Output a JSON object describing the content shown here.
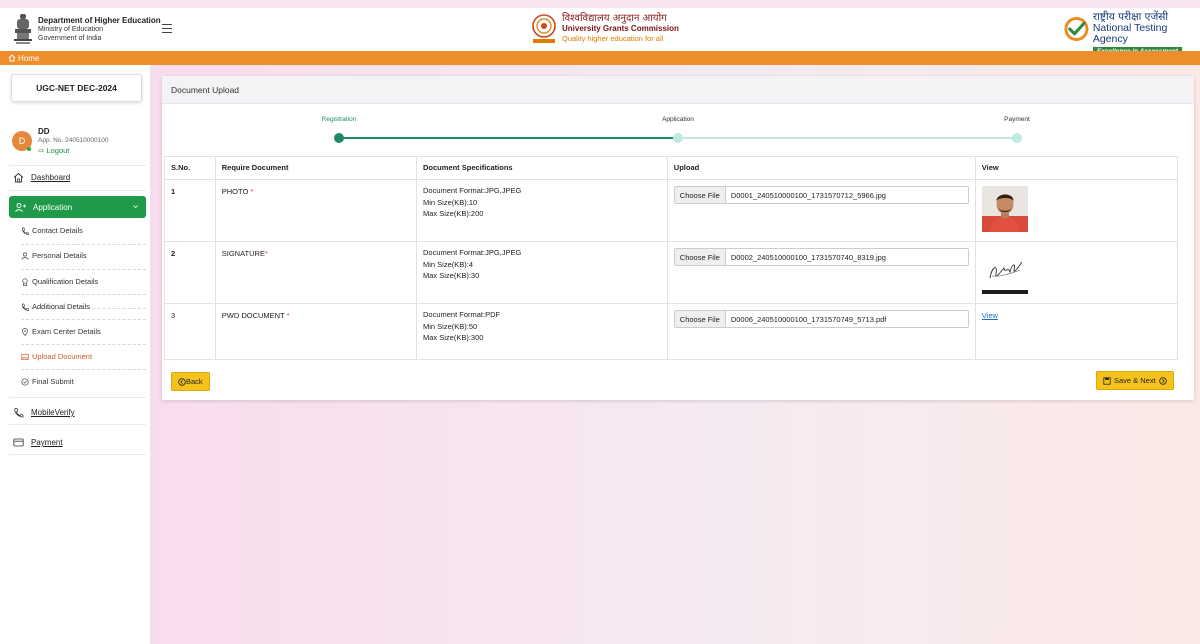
{
  "header": {
    "dept_line1": "Department of Higher Education",
    "dept_line2": "Ministry of Education",
    "dept_line3": "Government of India",
    "ugc_hindi": "विश्वविद्यालय अनुदान आयोग",
    "ugc_english": "University Grants Commission",
    "ugc_tagline": "Quality higher education for all",
    "nta_hindi": "राष्ट्रीय परीक्षा एजेंसी",
    "nta_english": "National Testing Agency",
    "nta_tagline": "Excellence in Assessment"
  },
  "topnav": {
    "home_label": "Home"
  },
  "sidebar": {
    "exam_name": "UGC-NET DEC-2024",
    "user": {
      "initial": "D",
      "name": "DD",
      "app_no": "App. No. 240510000100",
      "logout_label": "Logout"
    },
    "dashboard_label": "Dashboard",
    "application_label": "Application",
    "sub_items": [
      "Contact Details",
      "Personal Details",
      "Qualification Details",
      "Additional Details",
      "Exam Center Details",
      "Upload Document",
      "Final Submit"
    ],
    "mobile_verify_label": "MobileVerify",
    "payment_label": "Payment"
  },
  "card": {
    "title": "Document Upload",
    "steps": [
      "Registration",
      "Application",
      "Payment"
    ],
    "table": {
      "headers": [
        "S.No.",
        "Require Document",
        "Document Specifications",
        "Upload",
        "View"
      ],
      "rows": [
        {
          "sno": "1",
          "doc": "PHOTO",
          "spec1": "Document Format:JPG,JPEG",
          "spec2": "Min Size(KB):10",
          "spec3": "Max Size(KB):200",
          "choose_label": "Choose File",
          "file": "D0001_240510000100_1731570712_5966.jpg"
        },
        {
          "sno": "2",
          "doc": "SIGNATURE",
          "spec1": "Document Format:JPG,JPEG",
          "spec2": "Min Size(KB):4",
          "spec3": "Max Size(KB):30",
          "choose_label": "Choose File",
          "file": "D0002_240510000100_1731570740_8319.jpg"
        },
        {
          "sno": "3",
          "doc": "PWD DOCUMENT",
          "spec1": "Document Format:PDF",
          "spec2": "Min Size(KB):50",
          "spec3": "Max Size(KB):300",
          "choose_label": "Choose File",
          "file": "D0006_240510000100_1731570749_5713.pdf",
          "view_label": "View"
        }
      ]
    },
    "back_label": "Back",
    "save_next_label": "Save & Next"
  },
  "colors": {
    "accent_green": "#1e9a4a",
    "orange_bar": "#ee8d2c",
    "step_done": "#1e8a6a",
    "step_pending": "#bfe9e1",
    "button_yellow": "#f5c21b"
  }
}
